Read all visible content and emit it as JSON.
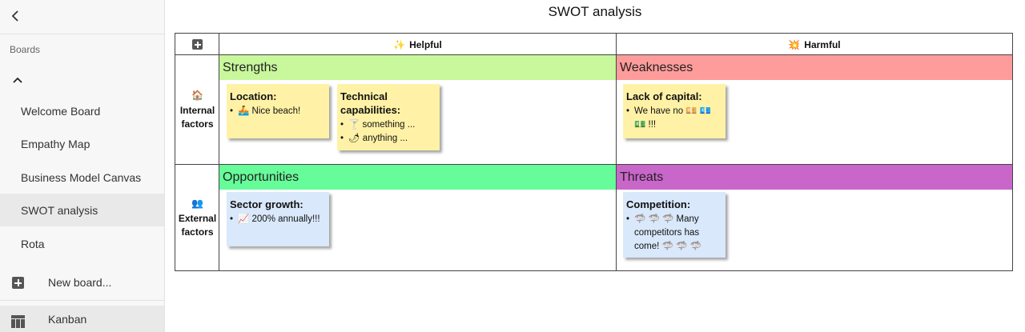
{
  "sidebar": {
    "back_icon": "chevron-left-icon",
    "section_label": "Boards",
    "collapse_icon": "chevron-up-icon",
    "items": [
      {
        "label": "Welcome Board"
      },
      {
        "label": "Empathy Map"
      },
      {
        "label": "Business Model Canvas"
      },
      {
        "label": "SWOT analysis",
        "active": true
      },
      {
        "label": "Rota"
      }
    ],
    "new_board_label": "New board...",
    "kanban_label": "Kanban"
  },
  "board": {
    "title": "SWOT analysis",
    "columns": [
      {
        "emoji": "✨",
        "label": "Helpful"
      },
      {
        "emoji": "💥",
        "label": "Harmful"
      }
    ],
    "rows": [
      {
        "emoji": "🏠",
        "label": "Internal factors"
      },
      {
        "emoji": "👥",
        "label": "External factors"
      }
    ],
    "quadrants": {
      "strengths": {
        "label": "Strengths",
        "color": "#c8f79c"
      },
      "weaknesses": {
        "label": "Weaknesses",
        "color": "#fd9c9a"
      },
      "opportunities": {
        "label": "Opportunities",
        "color": "#66fc99"
      },
      "threats": {
        "label": "Threats",
        "color": "#c966ca"
      }
    },
    "notes": {
      "location": {
        "title": "Location:",
        "items": [
          "🚣 Nice beach!"
        ]
      },
      "technical": {
        "title": "Technical capabilities:",
        "items": [
          "🍸 something ...",
          "🌶 anything ..."
        ]
      },
      "capital": {
        "title": "Lack of capital:",
        "item": "We have no 💴 💶 💵 !!!"
      },
      "sector": {
        "title": "Sector growth:",
        "items": [
          "📈 200% annually!!!"
        ]
      },
      "competition": {
        "title": "Competition:",
        "item": "🦈 🦈 🦈 Many competitors has come! 🦈 🦈 🦈"
      }
    }
  }
}
